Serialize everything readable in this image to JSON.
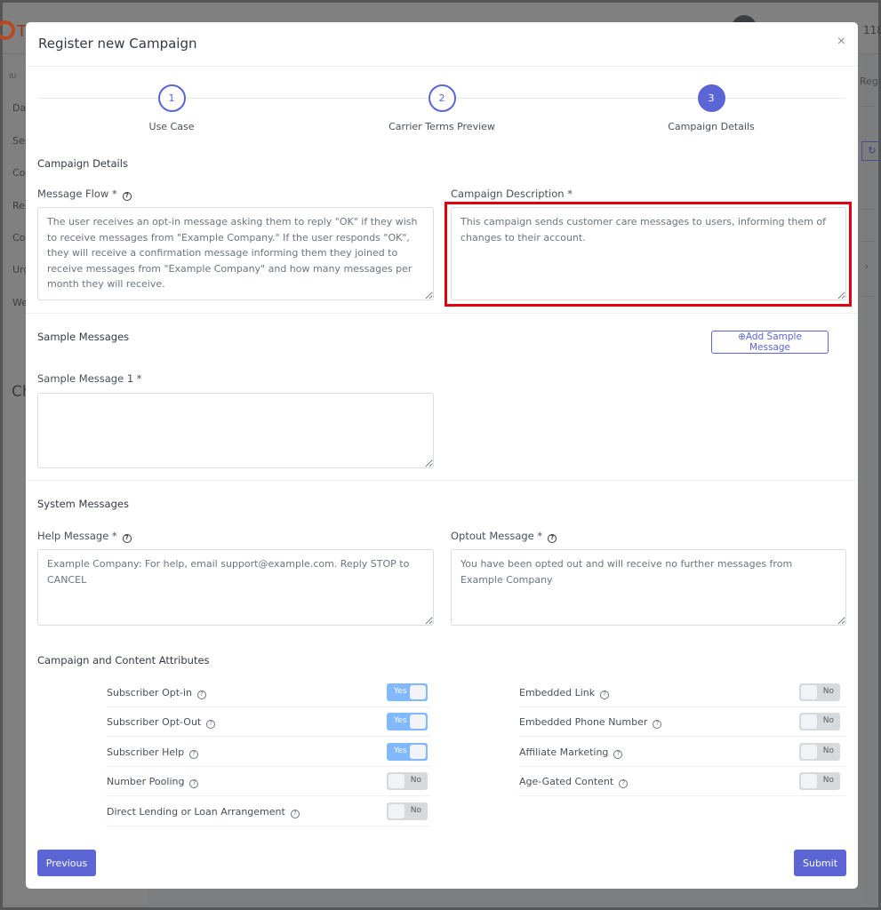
{
  "background": {
    "logo_text": "T",
    "ip_fragment": "118",
    "sidebar_heading": "IU",
    "sidebar_items": [
      "Das",
      "Sen",
      "Con",
      "Rep",
      "Con",
      "Urg",
      "Web"
    ],
    "page_heading_fragment": "Ch",
    "right_tab_fragment": "Regis"
  },
  "modal": {
    "title": "Register new Campaign",
    "close_label": "×",
    "steps": [
      {
        "number": "1",
        "label": "Use Case",
        "state": "completed"
      },
      {
        "number": "2",
        "label": "Carrier Terms Preview",
        "state": "completed"
      },
      {
        "number": "3",
        "label": "Campaign Details",
        "state": "active"
      }
    ],
    "campaign_details": {
      "section_title": "Campaign Details",
      "message_flow_label": "Message Flow *",
      "message_flow_value": "The user receives an opt-in message asking them to reply \"OK\" if they wish to receive messages from \"Example Company.\" If the user responds \"OK\", they will receive a confirmation message informing them they joined to receive messages from \"Example Company\" and how many messages per month they will receive.",
      "campaign_description_label": "Campaign Description *",
      "campaign_description_value": "This campaign sends customer care messages to users, informing them of changes to their account."
    },
    "sample_messages": {
      "section_title": "Sample Messages",
      "add_button_label": "⊕Add Sample Message",
      "sample_1_label": "Sample Message 1 *",
      "sample_1_value": ""
    },
    "system_messages": {
      "section_title": "System Messages",
      "help_label": "Help Message *",
      "help_value": "Example Company: For help, email support@example.com. Reply STOP to CANCEL",
      "optout_label": "Optout Message *",
      "optout_value": "You have been opted out and will receive no further messages from Example Company"
    },
    "attributes": {
      "section_title": "Campaign and Content Attributes",
      "help_glyph": "?",
      "left": [
        {
          "label": "Subscriber Opt-in",
          "value": true,
          "text": "Yes"
        },
        {
          "label": "Subscriber Opt-Out",
          "value": true,
          "text": "Yes"
        },
        {
          "label": "Subscriber Help",
          "value": true,
          "text": "Yes"
        },
        {
          "label": "Number Pooling",
          "value": false,
          "text": "No"
        },
        {
          "label": "Direct Lending or Loan Arrangement",
          "value": false,
          "text": "No"
        }
      ],
      "right": [
        {
          "label": "Embedded Link",
          "value": false,
          "text": "No"
        },
        {
          "label": "Embedded Phone Number",
          "value": false,
          "text": "No"
        },
        {
          "label": "Affiliate Marketing",
          "value": false,
          "text": "No"
        },
        {
          "label": "Age-Gated Content",
          "value": false,
          "text": "No"
        }
      ]
    },
    "footer": {
      "previous_label": "Previous",
      "submit_label": "Submit"
    },
    "colors": {
      "primary": "#5b65d3",
      "toggle_on": "#80b9ff",
      "toggle_off": "#d7dadd",
      "highlight": "#e1000f"
    }
  }
}
